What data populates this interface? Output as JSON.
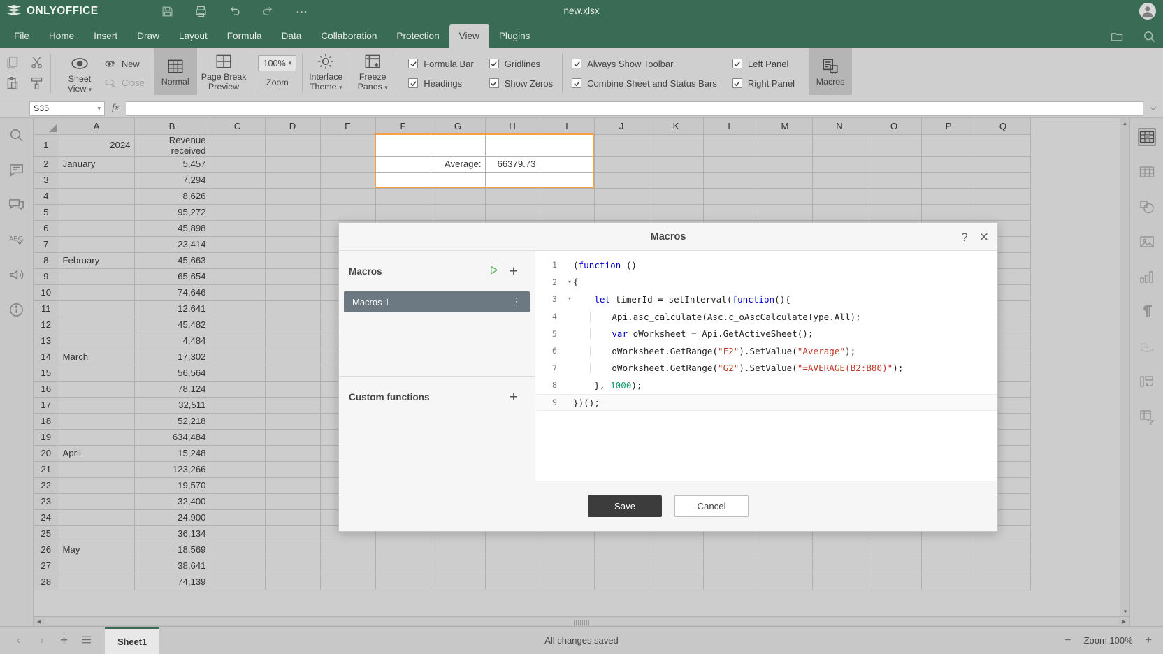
{
  "titlebar": {
    "brand": "ONLYOFFICE",
    "doc_title": "new.xlsx",
    "icons": [
      "save-icon",
      "print-icon",
      "undo-icon",
      "redo-icon",
      "more-icon"
    ]
  },
  "menu": {
    "tabs": [
      {
        "label": "File",
        "active": false
      },
      {
        "label": "Home",
        "active": false
      },
      {
        "label": "Insert",
        "active": false
      },
      {
        "label": "Draw",
        "active": false
      },
      {
        "label": "Layout",
        "active": false
      },
      {
        "label": "Formula",
        "active": false
      },
      {
        "label": "Data",
        "active": false
      },
      {
        "label": "Collaboration",
        "active": false
      },
      {
        "label": "Protection",
        "active": false
      },
      {
        "label": "View",
        "active": true
      },
      {
        "label": "Plugins",
        "active": false
      }
    ],
    "right_icons": [
      "open-file-location-icon",
      "search-icon"
    ]
  },
  "ribbon": {
    "copy_label": "copy-icon",
    "cut_label": "cut-icon",
    "paste_label": "paste-icon",
    "format_painter_label": "format-painter-icon",
    "sheet_view": {
      "label": "Sheet\nView",
      "new_label": "New",
      "close_label": "Close"
    },
    "sheet_view_title": "Sheet View",
    "new_label": "New",
    "close_label": "Close",
    "normal_label": "Normal",
    "page_break_label": "Page Break Preview",
    "zoom_value": "100%",
    "zoom_caption": "Zoom",
    "interface_theme_label": "Interface Theme",
    "freeze_panes_label": "Freeze Panes",
    "macros_label": "Macros",
    "checkboxes": [
      {
        "label": "Formula Bar",
        "checked": true
      },
      {
        "label": "Headings",
        "checked": true
      },
      {
        "label": "Gridlines",
        "checked": true
      },
      {
        "label": "Show Zeros",
        "checked": true
      },
      {
        "label": "Always Show Toolbar",
        "checked": true
      },
      {
        "label": "Combine Sheet and Status Bars",
        "checked": true
      },
      {
        "label": "Left Panel",
        "checked": true
      },
      {
        "label": "Right Panel",
        "checked": true
      }
    ]
  },
  "formula_bar": {
    "name_box": "S35",
    "fx_label": "fx",
    "formula_value": ""
  },
  "left_rail_icons": [
    "search-icon",
    "comments-icon",
    "chat-icon",
    "spellcheck-icon",
    "feedback-icon",
    "about-icon"
  ],
  "right_rail_icons": [
    "cell-settings-icon",
    "table-settings-icon",
    "shape-settings-icon",
    "image-settings-icon",
    "chart-settings-icon",
    "paragraph-settings-icon",
    "text-art-icon",
    "slicer-settings-icon",
    "pivot-table-icon"
  ],
  "grid": {
    "columns": [
      "A",
      "B",
      "C",
      "D",
      "E",
      "F",
      "G",
      "H",
      "I",
      "J",
      "K",
      "L",
      "M",
      "N",
      "O",
      "P",
      "Q"
    ],
    "rows": [
      {
        "n": 1,
        "A": "2024",
        "B": "Revenue received",
        "a_align": "right"
      },
      {
        "n": 2,
        "A": "January",
        "B": "5,457"
      },
      {
        "n": 3,
        "A": "",
        "B": "7,294"
      },
      {
        "n": 4,
        "A": "",
        "B": "8,626"
      },
      {
        "n": 5,
        "A": "",
        "B": "95,272"
      },
      {
        "n": 6,
        "A": "",
        "B": "45,898"
      },
      {
        "n": 7,
        "A": "",
        "B": "23,414"
      },
      {
        "n": 8,
        "A": "February",
        "B": "45,663"
      },
      {
        "n": 9,
        "A": "",
        "B": "65,654"
      },
      {
        "n": 10,
        "A": "",
        "B": "74,646"
      },
      {
        "n": 11,
        "A": "",
        "B": "12,641"
      },
      {
        "n": 12,
        "A": "",
        "B": "45,482"
      },
      {
        "n": 13,
        "A": "",
        "B": "4,484"
      },
      {
        "n": 14,
        "A": "March",
        "B": "17,302"
      },
      {
        "n": 15,
        "A": "",
        "B": "56,564"
      },
      {
        "n": 16,
        "A": "",
        "B": "78,124"
      },
      {
        "n": 17,
        "A": "",
        "B": "32,511"
      },
      {
        "n": 18,
        "A": "",
        "B": "52,218"
      },
      {
        "n": 19,
        "A": "",
        "B": "634,484"
      },
      {
        "n": 20,
        "A": "April",
        "B": "15,248"
      },
      {
        "n": 21,
        "A": "",
        "B": "123,266"
      },
      {
        "n": 22,
        "A": "",
        "B": "19,570"
      },
      {
        "n": 23,
        "A": "",
        "B": "32,400"
      },
      {
        "n": 24,
        "A": "",
        "B": "24,900"
      },
      {
        "n": 25,
        "A": "",
        "B": "36,134"
      },
      {
        "n": 26,
        "A": "May",
        "B": "18,569"
      },
      {
        "n": 27,
        "A": "",
        "B": "38,641"
      },
      {
        "n": 28,
        "A": "",
        "B": "74,139"
      }
    ],
    "average_label": "Average:",
    "average_value": "66379.73",
    "selection_accent": "#f5a142"
  },
  "dialog": {
    "title": "Macros",
    "help_label": "?",
    "close_label": "✕",
    "macros_section_title": "Macros",
    "macros_items": [
      {
        "label": "Macros 1",
        "selected": true
      }
    ],
    "custom_functions_title": "Custom functions",
    "run_icon": "run-macro-icon",
    "add_icon": "plus-icon",
    "save_label": "Save",
    "cancel_label": "Cancel",
    "code_lines": [
      {
        "n": 1,
        "fold": "",
        "indent": 0,
        "tokens": [
          {
            "t": "(",
            "c": ""
          },
          {
            "t": "function",
            "c": "kw"
          },
          {
            "t": " ()",
            "c": ""
          }
        ]
      },
      {
        "n": 2,
        "fold": "▾",
        "indent": 0,
        "tokens": [
          {
            "t": "{",
            "c": ""
          }
        ]
      },
      {
        "n": 3,
        "fold": "▾",
        "indent": 1,
        "tokens": [
          {
            "t": "let",
            "c": "kw"
          },
          {
            "t": " timerId = setInterval(",
            "c": ""
          },
          {
            "t": "function",
            "c": "kw"
          },
          {
            "t": "(){",
            "c": ""
          }
        ]
      },
      {
        "n": 4,
        "fold": "",
        "indent": 2,
        "tokens": [
          {
            "t": "Api.asc_calculate(Asc.c_oAscCalculateType.All);",
            "c": ""
          }
        ]
      },
      {
        "n": 5,
        "fold": "",
        "indent": 2,
        "tokens": [
          {
            "t": "var",
            "c": "kw"
          },
          {
            "t": " oWorksheet = Api.GetActiveSheet();",
            "c": ""
          }
        ]
      },
      {
        "n": 6,
        "fold": "",
        "indent": 2,
        "tokens": [
          {
            "t": "oWorksheet.GetRange(",
            "c": ""
          },
          {
            "t": "\"F2\"",
            "c": "str"
          },
          {
            "t": ").SetValue(",
            "c": ""
          },
          {
            "t": "\"Average\"",
            "c": "str"
          },
          {
            "t": ");",
            "c": ""
          }
        ]
      },
      {
        "n": 7,
        "fold": "",
        "indent": 2,
        "tokens": [
          {
            "t": "oWorksheet.GetRange(",
            "c": ""
          },
          {
            "t": "\"G2\"",
            "c": "str"
          },
          {
            "t": ").SetValue(",
            "c": ""
          },
          {
            "t": "\"=AVERAGE(B2:B80)\"",
            "c": "str"
          },
          {
            "t": ");",
            "c": ""
          }
        ]
      },
      {
        "n": 8,
        "fold": "",
        "indent": 1,
        "tokens": [
          {
            "t": "}, ",
            "c": ""
          },
          {
            "t": "1000",
            "c": "num2"
          },
          {
            "t": ");",
            "c": ""
          }
        ]
      },
      {
        "n": 9,
        "fold": "",
        "indent": 0,
        "tokens": [
          {
            "t": "})();",
            "c": ""
          }
        ]
      }
    ]
  },
  "statusbar": {
    "sheet_tab": "Sheet1",
    "status_text": "All changes saved",
    "zoom_label": "Zoom 100%",
    "zoom_out": "−",
    "zoom_in": "+"
  }
}
